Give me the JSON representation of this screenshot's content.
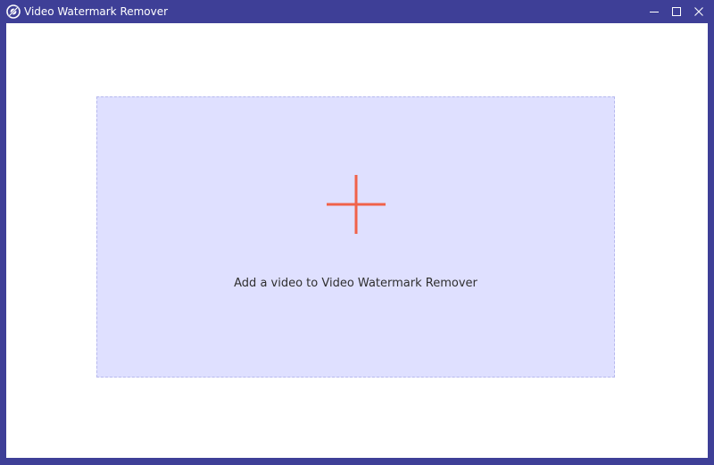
{
  "window": {
    "title": "Video Watermark Remover",
    "app_icon": "app-logo-icon",
    "controls": {
      "minimize_icon": "minimize-icon",
      "maximize_icon": "maximize-icon",
      "close_icon": "close-icon"
    }
  },
  "main": {
    "dropzone": {
      "icon": "plus-icon",
      "label": "Add a video to Video Watermark Remover"
    }
  },
  "colors": {
    "titlebar": "#3e3f97",
    "dropzone_bg": "#dfe0ff",
    "dropzone_border": "#b7b9ee",
    "plus_accent": "#f0624a",
    "client_bg": "#ffffff"
  }
}
